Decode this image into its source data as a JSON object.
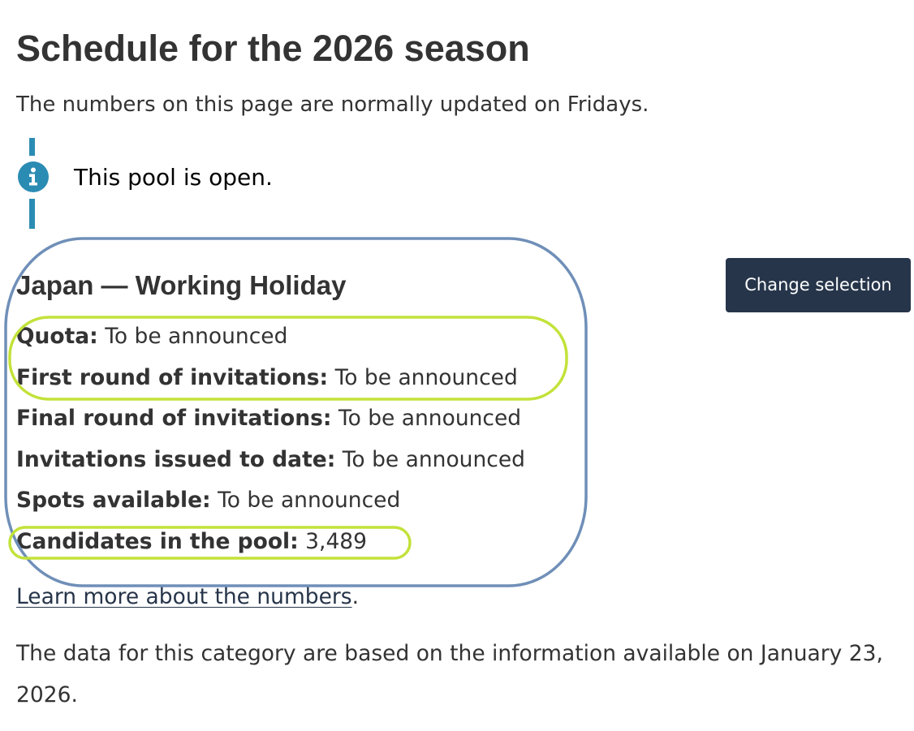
{
  "page": {
    "title": "Schedule for the 2026 season",
    "intro": "The numbers on this page are normally updated on Fridays."
  },
  "alert": {
    "icon": "info-icon",
    "color": "#2b8cb3",
    "message": "This pool is open."
  },
  "pool": {
    "title": "Japan — Working Holiday",
    "change_button_label": "Change selection",
    "stats": [
      {
        "label": "Quota:",
        "value": "To be announced"
      },
      {
        "label": "First round of invitations:",
        "value": "To be announced"
      },
      {
        "label": "Final round of invitations:",
        "value": "To be announced"
      },
      {
        "label": "Invitations issued to date:",
        "value": "To be announced"
      },
      {
        "label": "Spots available:",
        "value": "To be announced"
      },
      {
        "label": "Candidates in the pool:",
        "value": "3,489"
      }
    ]
  },
  "learn_more": {
    "link_text": "Learn more about the numbers",
    "suffix": "."
  },
  "footnote": "The data for this category are based on the information available on January 23, 2026.",
  "colors": {
    "text": "#333333",
    "button_bg": "#26354a",
    "annotation_blue": "#6f8fb8",
    "annotation_green": "#c2e23a"
  }
}
